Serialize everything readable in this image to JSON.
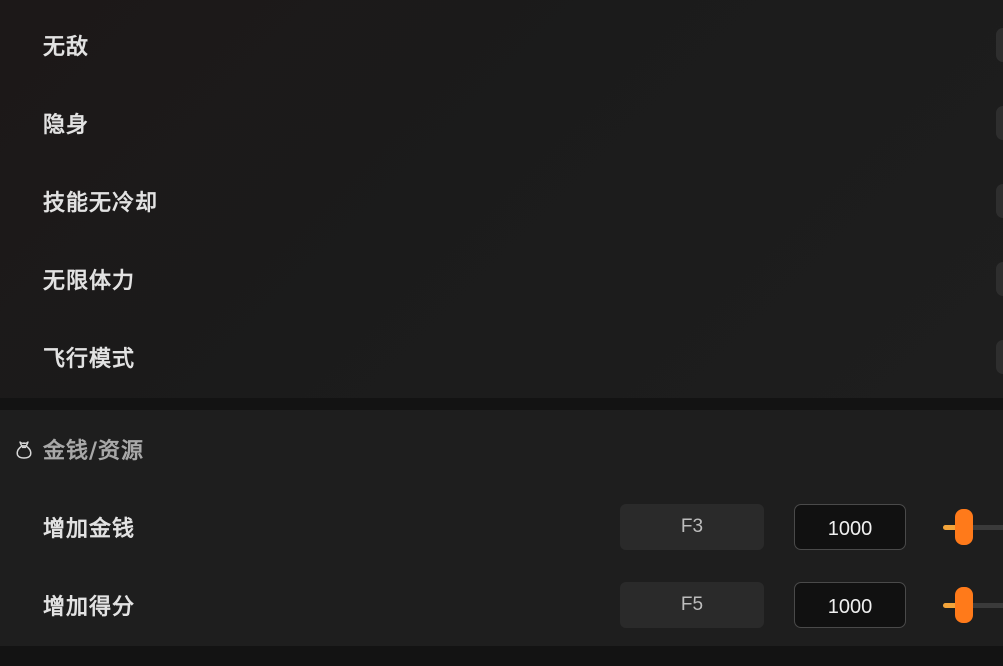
{
  "toggles": [
    {
      "label": "无敌"
    },
    {
      "label": "隐身"
    },
    {
      "label": "技能无冷却"
    },
    {
      "label": "无限体力"
    },
    {
      "label": "飞行模式"
    }
  ],
  "resources_section": {
    "icon": "money-bag-icon",
    "title": "金钱/资源",
    "items": [
      {
        "label": "增加金钱",
        "hotkey": "F3",
        "value": "1000",
        "slider_fraction": 0.25
      },
      {
        "label": "增加得分",
        "hotkey": "F5",
        "value": "1000",
        "slider_fraction": 0.25
      }
    ]
  },
  "colors": {
    "accent": "#ff7a1a",
    "slider_fill": "#f3a43a"
  }
}
